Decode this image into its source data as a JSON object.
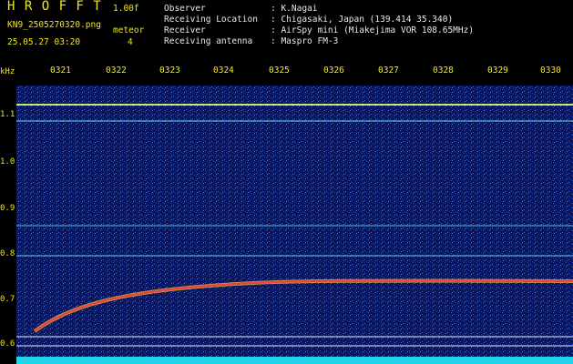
{
  "brand": "H R O F F T",
  "version": "1.00f",
  "filename": "KN9_2505270320.png",
  "mode": "meteor",
  "count": "4",
  "datetime": "25.05.27 03:20",
  "info": [
    {
      "label": "Observer",
      "value": ": K.Nagai"
    },
    {
      "label": "Receiving Location",
      "value": ": Chigasaki, Japan (139.414 35.340)"
    },
    {
      "label": "Receiver",
      "value": ": AirSpy mini (Miakejima VOR 108.65MHz)"
    },
    {
      "label": "Receiving antenna",
      "value": ": Maspro FM-3"
    }
  ],
  "time_ticks": [
    "0321",
    "0322",
    "0323",
    "0324",
    "0325",
    "0326",
    "0327",
    "0328",
    "0329",
    "0330"
  ],
  "freq_unit": "kHz",
  "freq_ticks": [
    "1.1",
    "1.0",
    "0.9",
    "0.8",
    "0.7",
    "0.6"
  ],
  "colors": {
    "background": "#0a1560",
    "text": "#f2e61a",
    "noise_floor": "#21d6ea"
  }
}
